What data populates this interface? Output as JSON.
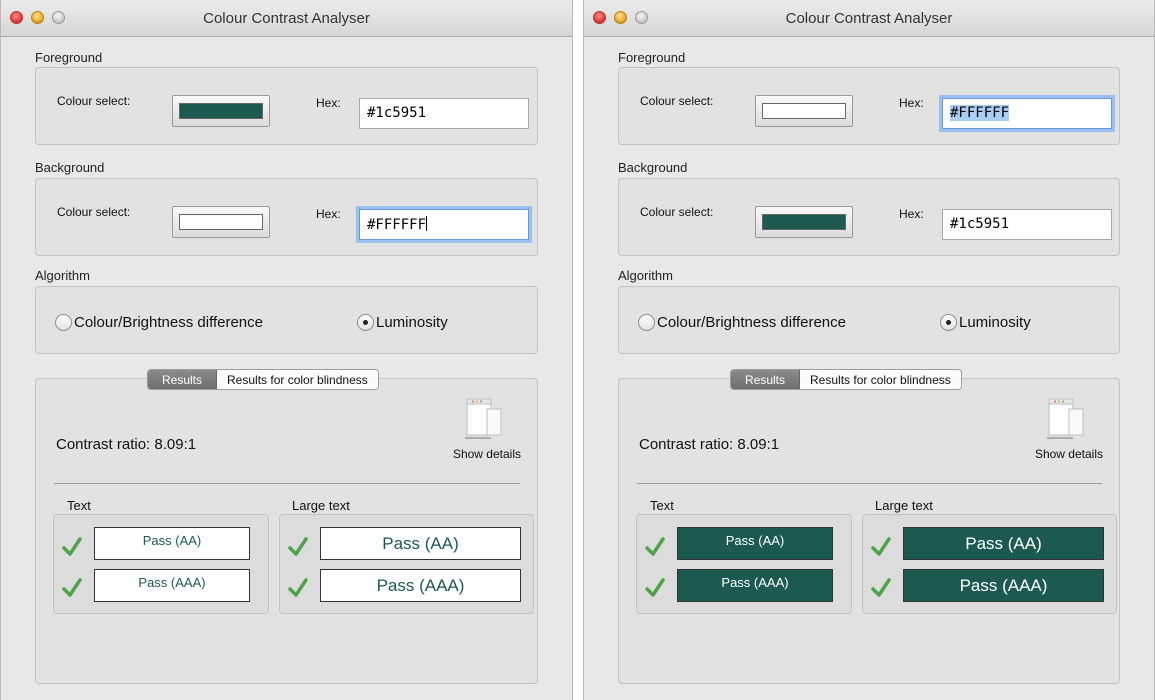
{
  "colors": {
    "accent": "#1c5951",
    "white": "#FFFFFF"
  },
  "windows": [
    {
      "title": "Colour Contrast Analyser",
      "foreground": {
        "section_label": "Foreground",
        "colour_select_label": "Colour select:",
        "hex_label": "Hex:",
        "hex_value": "#1c5951",
        "swatch_color": "#1c5951",
        "hex_focused": false
      },
      "background": {
        "section_label": "Background",
        "colour_select_label": "Colour select:",
        "hex_label": "Hex:",
        "hex_value": "#FFFFFF",
        "swatch_color": "#FFFFFF",
        "hex_focused": true
      },
      "algorithm": {
        "section_label": "Algorithm",
        "option_colour_brightness": "Colour/Brightness difference",
        "option_luminosity": "Luminosity",
        "selected": "Luminosity"
      },
      "results": {
        "tab_results": "Results",
        "tab_color_blindness": "Results for color blindness",
        "contrast_ratio": "Contrast ratio: 8.09:1",
        "show_details": "Show details",
        "text_label": "Text",
        "large_text_label": "Large text",
        "text_aa": "Pass (AA)",
        "text_aaa": "Pass (AAA)",
        "large_aa": "Pass (AA)",
        "large_aaa": "Pass (AAA)",
        "preview_style": "light"
      }
    },
    {
      "title": "Colour Contrast Analyser",
      "foreground": {
        "section_label": "Foreground",
        "colour_select_label": "Colour select:",
        "hex_label": "Hex:",
        "hex_value": "#FFFFFF",
        "swatch_color": "#FFFFFF",
        "hex_focused": true
      },
      "background": {
        "section_label": "Background",
        "colour_select_label": "Colour select:",
        "hex_label": "Hex:",
        "hex_value": "#1c5951",
        "swatch_color": "#1c5951",
        "hex_focused": false
      },
      "algorithm": {
        "section_label": "Algorithm",
        "option_colour_brightness": "Colour/Brightness difference",
        "option_luminosity": "Luminosity",
        "selected": "Luminosity"
      },
      "results": {
        "tab_results": "Results",
        "tab_color_blindness": "Results for color blindness",
        "contrast_ratio": "Contrast ratio: 8.09:1",
        "show_details": "Show details",
        "text_label": "Text",
        "large_text_label": "Large text",
        "text_aa": "Pass (AA)",
        "text_aaa": "Pass (AAA)",
        "large_aa": "Pass (AA)",
        "large_aaa": "Pass (AAA)",
        "preview_style": "dark"
      }
    }
  ]
}
